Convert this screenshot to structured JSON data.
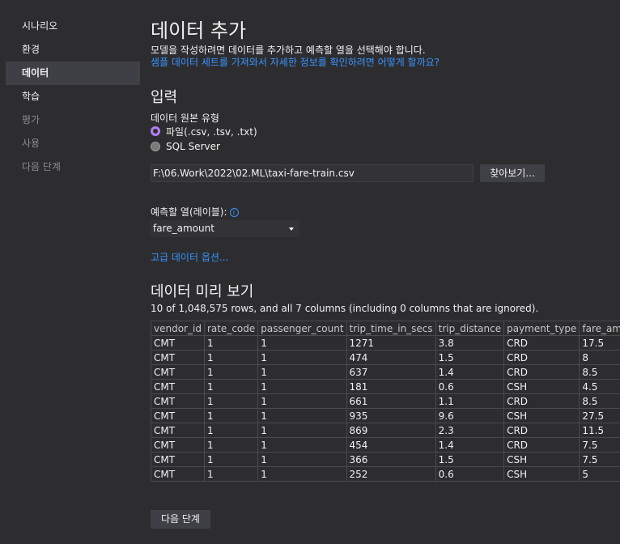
{
  "sidebar": {
    "items": [
      {
        "label": "시나리오"
      },
      {
        "label": "환경"
      },
      {
        "label": "데이터"
      },
      {
        "label": "학습"
      },
      {
        "label": "평가"
      },
      {
        "label": "사용"
      },
      {
        "label": "다음 단계"
      }
    ],
    "active_index": 2
  },
  "header": {
    "title": "데이터 추가",
    "description": "모델을 작성하려면 데이터를 추가하고 예측할 열을 선택해야 합니다.",
    "sample_link": "샘플 데이터 세트를 가져와서 자세한 정보를 확인하려면 어떻게 할까요?"
  },
  "input_section": {
    "title": "입력",
    "source_type_label": "데이터 원본 유형",
    "options": [
      {
        "label": "파일(.csv, .tsv, .txt)",
        "selected": true
      },
      {
        "label": "SQL Server",
        "selected": false
      }
    ],
    "file_path": "F:\\06.Work\\2022\\02.ML\\taxi-fare-train.csv",
    "browse_label": "찾아보기...",
    "predict_label": "예측할 열(레이블):",
    "info_icon": "info-icon",
    "predict_value": "fare_amount",
    "advanced_link": "고급 데이터 옵션..."
  },
  "preview": {
    "title": "데이터 미리 보기",
    "summary": "10 of 1,048,575 rows, and all 7 columns (including 0 columns that are ignored).",
    "columns": [
      "vendor_id",
      "rate_code",
      "passenger_count",
      "trip_time_in_secs",
      "trip_distance",
      "payment_type",
      "fare_amount"
    ],
    "rows": [
      [
        "CMT",
        "1",
        "1",
        "1271",
        "3.8",
        "CRD",
        "17.5"
      ],
      [
        "CMT",
        "1",
        "1",
        "474",
        "1.5",
        "CRD",
        "8"
      ],
      [
        "CMT",
        "1",
        "1",
        "637",
        "1.4",
        "CRD",
        "8.5"
      ],
      [
        "CMT",
        "1",
        "1",
        "181",
        "0.6",
        "CSH",
        "4.5"
      ],
      [
        "CMT",
        "1",
        "1",
        "661",
        "1.1",
        "CRD",
        "8.5"
      ],
      [
        "CMT",
        "1",
        "1",
        "935",
        "9.6",
        "CSH",
        "27.5"
      ],
      [
        "CMT",
        "1",
        "1",
        "869",
        "2.3",
        "CRD",
        "11.5"
      ],
      [
        "CMT",
        "1",
        "1",
        "454",
        "1.4",
        "CRD",
        "7.5"
      ],
      [
        "CMT",
        "1",
        "1",
        "366",
        "1.5",
        "CSH",
        "7.5"
      ],
      [
        "CMT",
        "1",
        "1",
        "252",
        "0.6",
        "CSH",
        "5"
      ]
    ]
  },
  "footer": {
    "next_label": "다음 단계"
  },
  "colors": {
    "background": "#2d2d30",
    "link": "#3794ff",
    "radio_accent": "#b180f0"
  }
}
